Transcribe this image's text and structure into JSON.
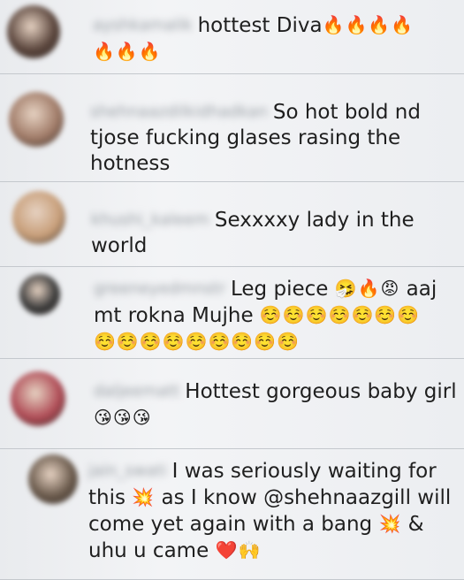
{
  "comments": [
    {
      "username": "ayshkamalik",
      "avatar_color": "#5b463d",
      "parts": [
        {
          "t": "hottest Diva"
        },
        {
          "e": "🔥🔥🔥🔥"
        },
        {
          "e": "🔥🔥🔥"
        }
      ]
    },
    {
      "username": "shehnaazdilkidhadkan",
      "avatar_color": "#a07b68",
      "parts": [
        {
          "t": "So hot bold nd tjose fucking glases rasing the hotness"
        }
      ]
    },
    {
      "username": "khushi_kaleem",
      "avatar_color": "#c89f7a",
      "parts": [
        {
          "t": "Sexxxxy lady in the world"
        }
      ]
    },
    {
      "username": "greeneyedmnstr",
      "avatar_color": "#3b3b3b",
      "parts": [
        {
          "t": "Leg piece "
        },
        {
          "e": "🤧🔥😡"
        },
        {
          "t": " aaj mt rokna Mujhe "
        },
        {
          "e": "☺️☺️☺️☺️☺️☺️☺️"
        },
        {
          "e": "☺️☺️☺️☺️☺️☺️☺️☺️☺️"
        }
      ]
    },
    {
      "username": "daljeematt",
      "avatar_color": "#b04d57",
      "parts": [
        {
          "t": "Hottest gorgeous baby girl "
        },
        {
          "e": "😘😘😘"
        }
      ]
    },
    {
      "username": "jain_swati",
      "avatar_color": "#6a5a4c",
      "parts": [
        {
          "t": "I was seriously waiting for this "
        },
        {
          "e": "💥"
        },
        {
          "t": " as I know @shehnaazgill will come yet again with a bang "
        },
        {
          "e": "💥"
        },
        {
          "t": " & uhu u came "
        },
        {
          "e": "❤️🙌"
        }
      ]
    }
  ]
}
